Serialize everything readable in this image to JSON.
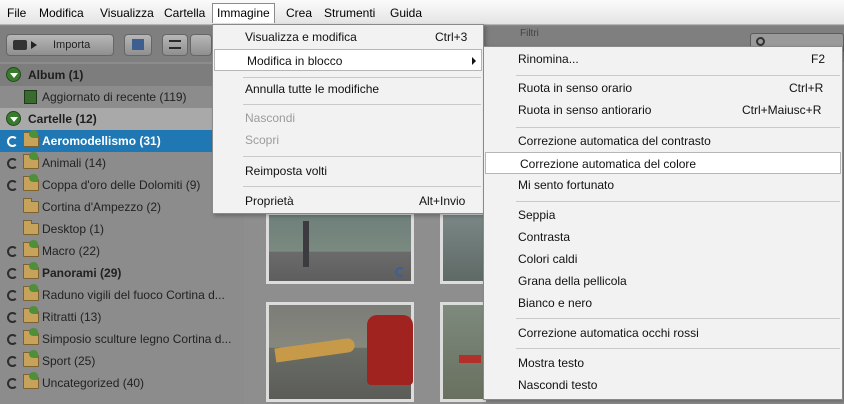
{
  "menubar": {
    "items": [
      "File",
      "Modifica",
      "Visualizza",
      "Cartella",
      "Immagine",
      "Crea",
      "Strumenti",
      "Guida"
    ],
    "active": "Immagine"
  },
  "toolbar": {
    "import_label": "Importa",
    "filters_label": "Filtri",
    "search_placeholder": ""
  },
  "sidebar": {
    "album_header": "Album (1)",
    "album_items": [
      "Aggiornato di recente (119)"
    ],
    "folders_header": "Cartelle (12)",
    "folders": [
      {
        "label": "Aeromodellismo (31)",
        "selected": true,
        "bold": true,
        "sync": true
      },
      {
        "label": "Animali (14)",
        "sync": true
      },
      {
        "label": "Coppa d'oro delle Dolomiti (9)",
        "sync": true
      },
      {
        "label": "Cortina d'Ampezzo (2)",
        "sync": false
      },
      {
        "label": "Desktop (1)",
        "sync": false
      },
      {
        "label": "Macro (22)",
        "sync": true
      },
      {
        "label": "Panorami (29)",
        "sync": true,
        "bold": true
      },
      {
        "label": "Raduno vigili del fuoco Cortina d...",
        "sync": true
      },
      {
        "label": "Ritratti (13)",
        "sync": true
      },
      {
        "label": "Simposio sculture legno Cortina d...",
        "sync": true
      },
      {
        "label": "Sport (25)",
        "sync": true
      },
      {
        "label": "Uncategorized (40)",
        "sync": true
      }
    ]
  },
  "image_menu": {
    "items": [
      {
        "label": "Visualizza e modifica",
        "shortcut": "Ctrl+3"
      },
      {
        "label": "Modifica in blocco",
        "shortcut": "",
        "submenu": true,
        "highlighted": true
      },
      {
        "label": "Annulla tutte le modifiche",
        "shortcut": ""
      },
      {
        "label": "Nascondi",
        "shortcut": "",
        "disabled": true
      },
      {
        "label": "Scopri",
        "shortcut": "",
        "disabled": true
      },
      {
        "label": "Reimposta volti",
        "shortcut": ""
      },
      {
        "label": "Proprietà",
        "shortcut": "Alt+Invio"
      }
    ]
  },
  "batch_submenu": {
    "items": [
      {
        "label": "Rinomina...",
        "shortcut": "F2"
      },
      {
        "label": "Ruota in senso orario",
        "shortcut": "Ctrl+R"
      },
      {
        "label": "Ruota in senso antiorario",
        "shortcut": "Ctrl+Maiusc+R"
      },
      {
        "label": "Correzione automatica del contrasto",
        "shortcut": ""
      },
      {
        "label": "Correzione automatica del colore",
        "shortcut": "",
        "highlighted": true
      },
      {
        "label": "Mi sento fortunato",
        "shortcut": ""
      },
      {
        "label": "Seppia",
        "shortcut": ""
      },
      {
        "label": "Contrasta",
        "shortcut": ""
      },
      {
        "label": "Colori caldi",
        "shortcut": ""
      },
      {
        "label": "Grana della pellicola",
        "shortcut": ""
      },
      {
        "label": "Bianco e nero",
        "shortcut": ""
      },
      {
        "label": "Correzione automatica occhi rossi",
        "shortcut": ""
      },
      {
        "label": "Mostra testo",
        "shortcut": ""
      },
      {
        "label": "Nascondi testo",
        "shortcut": ""
      }
    ]
  },
  "colors": {
    "selection_blue": "#1f78b4",
    "menu_bg": "#f2f2f2",
    "dimmed_bg": "#8a8a8a"
  }
}
